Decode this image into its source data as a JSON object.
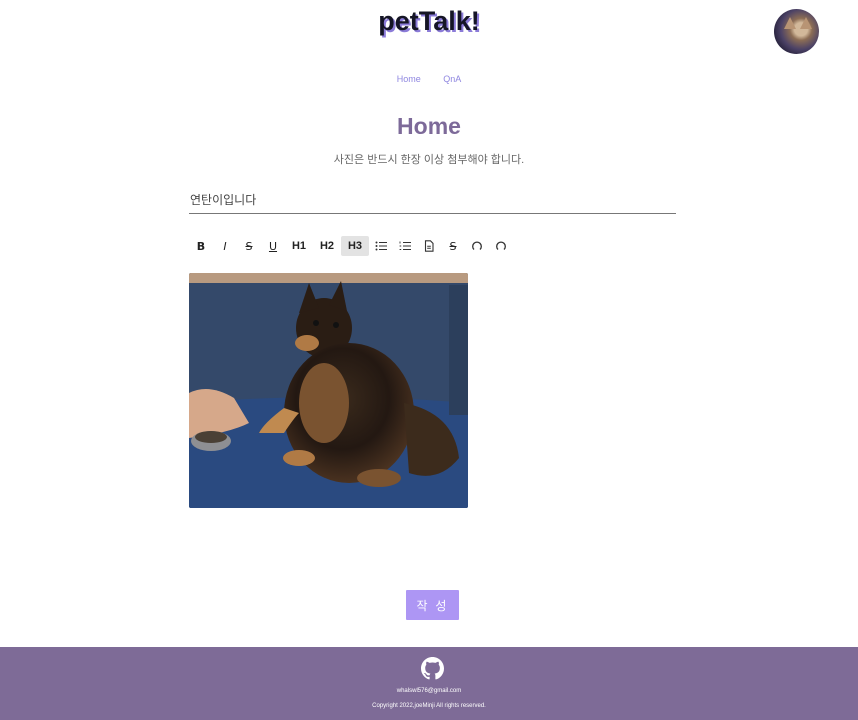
{
  "header": {
    "logo": "petTalk!"
  },
  "nav": {
    "items": [
      "Home",
      "QnA"
    ]
  },
  "main": {
    "title": "Home",
    "subtitle": "사진은 반드시 한장 이상 첨부해야 합니다.",
    "title_input_value": "연탄이입니다"
  },
  "toolbar": {
    "buttons": [
      {
        "label": "B",
        "icon": "bold-icon"
      },
      {
        "label": "I",
        "icon": "italic-icon"
      },
      {
        "label": "S",
        "icon": "strike-icon"
      },
      {
        "label": "U",
        "icon": "underline-icon"
      },
      {
        "label": "H1",
        "icon": "heading1"
      },
      {
        "label": "H2",
        "icon": "heading2"
      },
      {
        "label": "H3",
        "icon": "heading3",
        "active": true
      },
      {
        "label": "",
        "icon": "bullet-list-icon"
      },
      {
        "label": "",
        "icon": "ordered-list-icon"
      },
      {
        "label": "",
        "icon": "file-icon"
      },
      {
        "label": "S",
        "icon": "strike-icon"
      },
      {
        "label": "",
        "icon": "undo-icon"
      },
      {
        "label": "",
        "icon": "redo-icon"
      }
    ]
  },
  "submit": {
    "label": "작 성"
  },
  "footer": {
    "icon": "github-icon",
    "email": "whalswl576@gmail.com",
    "copyright": "Copyright 2022,joeMinji All rights reserved."
  },
  "colors": {
    "accent": "#ad96f4",
    "footer_bg": "#7e6b97",
    "title": "#7d6a99",
    "nav_link": "#8f87e0"
  }
}
